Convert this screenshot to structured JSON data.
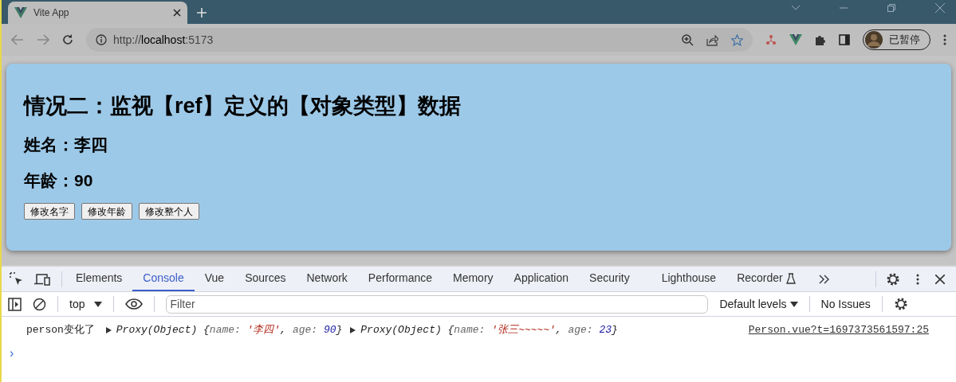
{
  "browser": {
    "tab_title": "Vite App",
    "url_scheme": "http://",
    "url_host": "localhost",
    "url_port": ":5173",
    "profile_label": "已暂停"
  },
  "page": {
    "title": "情况二：监视【ref】定义的【对象类型】数据",
    "lines": [
      "姓名：李四",
      "年龄：90"
    ],
    "buttons": [
      "修改名字",
      "修改年龄",
      "修改整个人"
    ]
  },
  "devtools": {
    "tabs": [
      {
        "label": "Elements",
        "selected": false
      },
      {
        "label": "Console",
        "selected": true
      },
      {
        "label": "Vue",
        "selected": false
      },
      {
        "label": "Sources",
        "selected": false
      },
      {
        "label": "Network",
        "selected": false
      },
      {
        "label": "Performance",
        "selected": false
      },
      {
        "label": "Memory",
        "selected": false
      },
      {
        "label": "Application",
        "selected": false
      },
      {
        "label": "Security",
        "selected": false
      },
      {
        "label": "Lighthouse",
        "selected": false
      },
      {
        "label": "Recorder",
        "selected": false
      }
    ],
    "context": "top",
    "filter_placeholder": "Filter",
    "levels": "Default levels",
    "issues": "No Issues",
    "log": {
      "text": "person变化了",
      "objects": [
        {
          "segments": [
            {
              "text": "Proxy(Object) {",
              "kind": "plain"
            },
            {
              "text": "name: ",
              "kind": "key"
            },
            {
              "text": "'李四'",
              "kind": "string"
            },
            {
              "text": ", ",
              "kind": "plain"
            },
            {
              "text": "age: ",
              "kind": "key"
            },
            {
              "text": "90",
              "kind": "number"
            },
            {
              "text": "}",
              "kind": "plain"
            }
          ]
        },
        {
          "segments": [
            {
              "text": "Proxy(Object) {",
              "kind": "plain"
            },
            {
              "text": "name: ",
              "kind": "key"
            },
            {
              "text": "'张三~~~~~'",
              "kind": "string"
            },
            {
              "text": ", ",
              "kind": "plain"
            },
            {
              "text": "age: ",
              "kind": "key"
            },
            {
              "text": "23",
              "kind": "number"
            },
            {
              "text": "}",
              "kind": "plain"
            }
          ]
        }
      ],
      "source": "Person.vue?t=1697373561597:25"
    },
    "prompt": "›"
  }
}
